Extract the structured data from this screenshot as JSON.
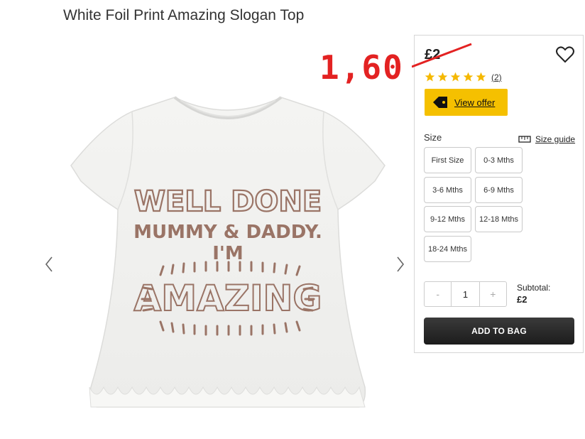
{
  "product": {
    "title": "White Foil Print Amazing Slogan Top",
    "image_alt_text": [
      "WELL DONE",
      "MUMMY & DADDY.",
      "I'M",
      "AMAZING"
    ]
  },
  "annotation": {
    "price_text": "1,60",
    "color": "#e32222"
  },
  "panel": {
    "old_price": "£2",
    "rating": {
      "stars": 5,
      "max": 5,
      "count_label": "(2)"
    },
    "offer": {
      "label": "View offer",
      "color": "#f5c000"
    },
    "size": {
      "label": "Size",
      "guide_label": "Size guide",
      "options": [
        "First Size",
        "0-3 Mths",
        "3-6 Mths",
        "6-9 Mths",
        "9-12 Mths",
        "12-18 Mths",
        "18-24 Mths"
      ]
    },
    "quantity": {
      "minus": "-",
      "value": "1",
      "plus": "+"
    },
    "subtotal": {
      "label": "Subtotal:",
      "amount": "£2"
    },
    "add_to_bag": "ADD TO BAG"
  },
  "icons": {
    "prev": "chevron-left-icon",
    "next": "chevron-right-icon",
    "wishlist": "heart-icon",
    "offer": "tag-icon",
    "size_guide": "ruler-icon",
    "star": "star-icon"
  }
}
